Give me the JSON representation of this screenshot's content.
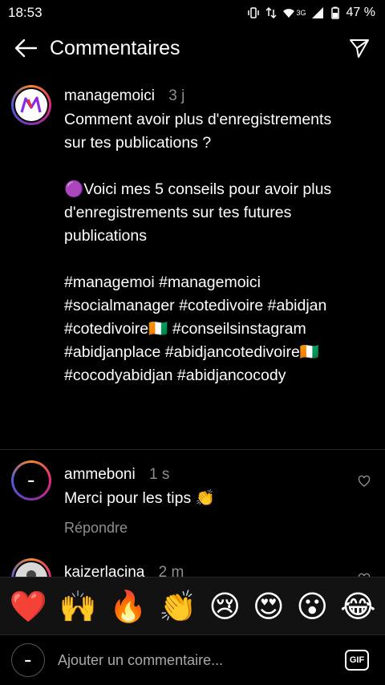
{
  "status": {
    "time": "18:53",
    "battery": "47 %",
    "network": "3G"
  },
  "header": {
    "title": "Commentaires"
  },
  "comments": [
    {
      "user": "managemoici",
      "time": "3 j",
      "text": "Comment avoir plus d'enregistrements sur tes publications ?\n\n🟣Voici mes 5 conseils pour avoir plus d'enregistrements sur tes futures publications\n\n#managemoi #managemoici #socialmanager #cotedivoire #abidjan #cotedivoire🇨🇮 #conseilsinstagram #abidjanplace #abidjancotedivoire🇨🇮 #cocodyabidjan #abidjancocody"
    },
    {
      "user": "ammeboni",
      "time": "1 s",
      "text": "Merci pour les tips 👏",
      "reply": "Répondre"
    },
    {
      "user": "kaizerlacina",
      "time": "2 m",
      "text": ""
    }
  ],
  "emoji_bar": [
    "❤️",
    "🙌",
    "🔥",
    "👏",
    "😢",
    "😍",
    "😮",
    "😂"
  ],
  "composer": {
    "placeholder": "Ajouter un commentaire...",
    "gif_label": "GIF"
  },
  "colors": {
    "background": "#000000",
    "secondary_text": "#8e8e8e",
    "divider": "#262626"
  }
}
